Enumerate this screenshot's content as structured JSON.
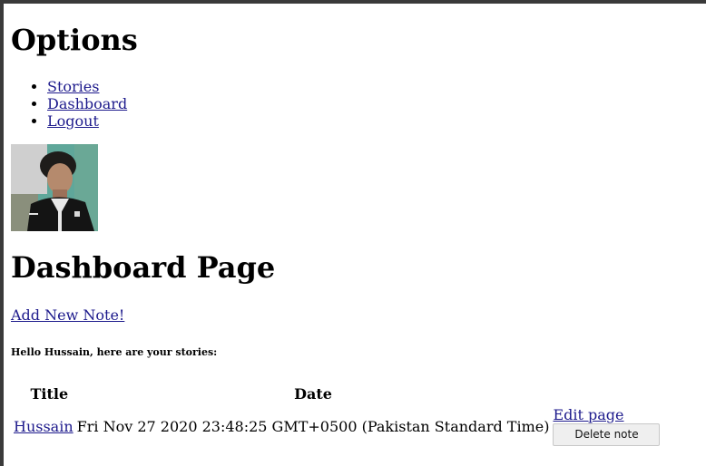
{
  "options": {
    "title": "Options",
    "links": [
      "Stories",
      "Dashboard",
      "Logout"
    ]
  },
  "dashboard": {
    "title": "Dashboard Page",
    "add_link": "Add New Note!",
    "greeting": "Hello Hussain, here are your stories:"
  },
  "table": {
    "headers": [
      "Title",
      "Date"
    ],
    "rows": [
      {
        "title": "Hussain",
        "date": "Fri Nov 27 2020 23:48:25 GMT+0500 (Pakistan Standard Time)",
        "edit_label": "Edit page",
        "delete_label": "Delete note"
      }
    ]
  }
}
